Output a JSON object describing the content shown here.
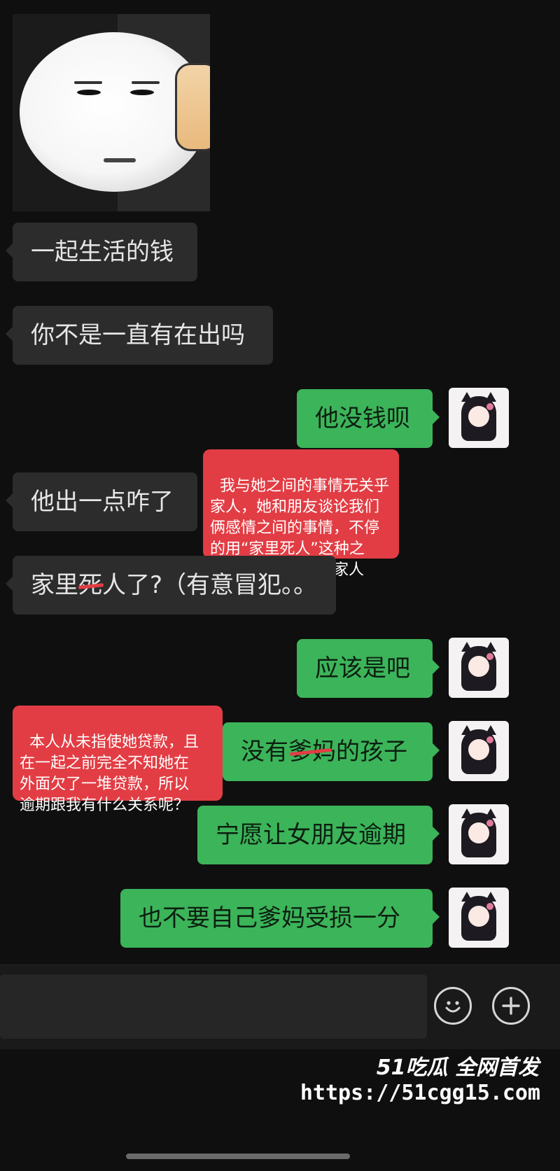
{
  "messages": {
    "m1": "一起生活的钱",
    "m2": "你不是一直有在出吗",
    "m3": "他没钱呗",
    "m4": "他出一点咋了",
    "m5": "家里死人了?（有意冒犯。。",
    "m6": "应该是吧",
    "m7": "没有爹妈的孩子",
    "m8": "宁愿让女朋友逾期",
    "m9": "也不要自己爹妈受损一分"
  },
  "annotations": {
    "note1": "我与她之间的事情无关乎\n家人，她和朋友谈论我们\n俩感情之间的事情，不停\n的用“家里死人”这种之\n类的话来攻击我的家人",
    "note2": "本人从未指使她贷款，且\n在一起之前完全不知她在\n外面欠了一堆贷款，所以\n逾期跟我有什么关系呢？"
  },
  "watermark": {
    "brand": "51吃瓜 全网首发",
    "url": "https://51cgg15.com"
  },
  "icons": {
    "emoji": "smiley-face-icon",
    "add": "plus-circle-icon"
  },
  "colors": {
    "background": "#0f0f0f",
    "incoming": "#2c2c2c",
    "outgoing": "#3cb45a",
    "annotation": "#e23d44"
  }
}
